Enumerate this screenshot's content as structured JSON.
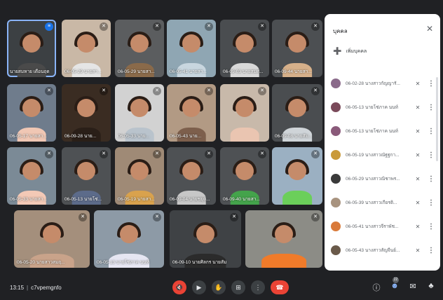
{
  "tiles": [
    {
      "name": "นายสมหาย เดือนฤด",
      "bg": "#3c4043",
      "body": "#4a4a4a",
      "speaking": true
    },
    {
      "name": "06-05-29 นายสา...",
      "bg": "#c9b8a6",
      "body": "#e5e5e5",
      "speaking": false
    },
    {
      "name": "06-05-29 นายสา...",
      "bg": "#5b5d5f",
      "body": "#8a6a4a",
      "speaking": false
    },
    {
      "name": "06-05-41 นายสา...",
      "bg": "#8fa6b3",
      "body": "#c8d6df",
      "speaking": false
    },
    {
      "name": "06-09-03 นายสมศ...",
      "bg": "#4a4d50",
      "body": "#d9d9d9",
      "speaking": false
    },
    {
      "name": "06-09-44 นายสา...",
      "bg": "#4c4f52",
      "body": "#d6b08a",
      "speaking": false
    },
    {
      "name": "06-05-17 นายสา...",
      "bg": "#6f7c8c",
      "body": "#f0c7b4",
      "speaking": false
    },
    {
      "name": "06-09-28 นาย...",
      "bg": "#3a2c22",
      "body": "#2a1f18",
      "speaking": false
    },
    {
      "name": "06-05-33 นาย...",
      "bg": "#d2d2d2",
      "body": "#b9c3cc",
      "speaking": false
    },
    {
      "name": "06-05-43 นาย...",
      "bg": "#b29a84",
      "body": "#7d5f4c",
      "speaking": false
    },
    {
      "name": "",
      "bg": "#c8b9aa",
      "body": "#eac5b1",
      "speaking": false
    },
    {
      "name": "06-09-08 นายสัม...",
      "bg": "#4a4d50",
      "body": "#cfd4d8",
      "speaking": false
    },
    {
      "name": "06-05-33 นายสา...",
      "bg": "#7b8a96",
      "body": "#f3c9b6",
      "speaking": false
    },
    {
      "name": "06-05-13 นายโซ่...",
      "bg": "#4e5154",
      "body": "#5c6b8a",
      "speaking": false
    },
    {
      "name": "06-05-19 นายสา...",
      "bg": "#9f8a76",
      "body": "#d9a24d",
      "speaking": false
    },
    {
      "name": "06-09-04 นายชยุต...",
      "bg": "#4e5154",
      "body": "#c7c7c7",
      "speaking": false
    },
    {
      "name": "06-09-40 นายสา...",
      "bg": "#4e5154",
      "body": "#44a34b",
      "speaking": false
    },
    {
      "name": "",
      "bg": "#9bb0c2",
      "body": "#6bcf5a",
      "speaking": false
    },
    {
      "name": "06-05-20 นายสาวสมฤ...",
      "bg": "#a48f7c",
      "body": "#c9a38a",
      "speaking": false
    },
    {
      "name": "06-05-13 นายโซ่ภาค นนท์",
      "bg": "#8d9aa6",
      "body": "#e6e6f2",
      "speaking": false
    },
    {
      "name": "06-09-10 นายศิลกร นายสัม",
      "bg": "#3f4245",
      "body": "#2b2b2b",
      "speaking": false
    },
    {
      "name": "",
      "bg": "#8c8c86",
      "body": "#f07b2a",
      "speaking": false
    }
  ],
  "panel": {
    "title": "บุคคล",
    "close_glyph": "✕",
    "add_label": "เพิ่มบุคคล",
    "people": [
      {
        "name": "06-02-28 นางสาวกัญญารั...",
        "color": "#8a6a8a"
      },
      {
        "name": "06-05-13 นายโซ่ภาค นนท์",
        "color": "#7a4a5a"
      },
      {
        "name": "06-05-13 นายโซ่ภาค นนท์",
        "color": "#8a5a7a"
      },
      {
        "name": "06-05-19 นางสาวณัฐฐกา...",
        "color": "#c99a3a"
      },
      {
        "name": "06-05-29 นางสาวณิชาพร...",
        "color": "#3a3a3a"
      },
      {
        "name": "06-05-39 นางสาวเกียรติ...",
        "color": "#a8937f"
      },
      {
        "name": "06-05-41 นางสาวจีราพัช...",
        "color": "#d97a3a"
      },
      {
        "name": "06-05-43 นางสาวสัญจีนย์...",
        "color": "#6a5a4a"
      }
    ]
  },
  "bottom": {
    "time": "13:15",
    "separator": "|",
    "code": "c7vpemgnfo",
    "participant_count": "22"
  },
  "icons": {
    "mic_off": "✎",
    "mic_on": "●",
    "more": "⋮"
  }
}
